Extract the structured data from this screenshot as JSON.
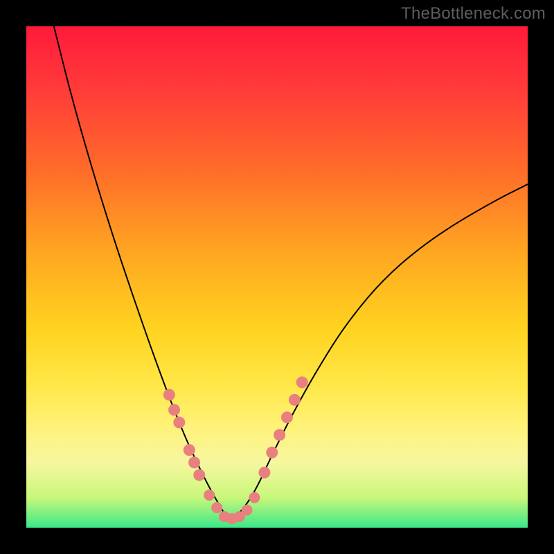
{
  "watermark": "TheBottleneck.com",
  "chart_data": {
    "type": "line",
    "title": "",
    "xlabel": "",
    "ylabel": "",
    "xlim": [
      0,
      1
    ],
    "ylim": [
      0,
      1
    ],
    "series": [
      {
        "name": "curve",
        "x": [
          0.055,
          0.09,
          0.13,
          0.17,
          0.21,
          0.25,
          0.285,
          0.315,
          0.34,
          0.365,
          0.385,
          0.4,
          0.415,
          0.435,
          0.46,
          0.49,
          0.53,
          0.58,
          0.64,
          0.72,
          0.82,
          0.93,
          1.0
        ],
        "y": [
          1.0,
          0.86,
          0.72,
          0.59,
          0.47,
          0.355,
          0.26,
          0.185,
          0.13,
          0.08,
          0.045,
          0.02,
          0.02,
          0.04,
          0.08,
          0.145,
          0.225,
          0.315,
          0.41,
          0.505,
          0.585,
          0.65,
          0.685
        ],
        "stroke": "#000000",
        "stroke_width": 2
      }
    ],
    "markers": [
      {
        "name": "left-band-upper",
        "x": [
          0.285,
          0.295,
          0.305
        ],
        "y": [
          0.265,
          0.235,
          0.21
        ],
        "color": "#e98080",
        "size": 11
      },
      {
        "name": "left-band-mid",
        "x": [
          0.325,
          0.335,
          0.345
        ],
        "y": [
          0.155,
          0.13,
          0.105
        ],
        "color": "#e98080",
        "size": 11
      },
      {
        "name": "bottom-cluster",
        "x": [
          0.365,
          0.38,
          0.395,
          0.41,
          0.425,
          0.44,
          0.455
        ],
        "y": [
          0.065,
          0.04,
          0.022,
          0.018,
          0.022,
          0.035,
          0.06
        ],
        "color": "#e98080",
        "size": 10
      },
      {
        "name": "right-band",
        "x": [
          0.475,
          0.49,
          0.505,
          0.52,
          0.535,
          0.55
        ],
        "y": [
          0.11,
          0.15,
          0.185,
          0.22,
          0.255,
          0.29
        ],
        "color": "#e98080",
        "size": 11
      }
    ]
  }
}
